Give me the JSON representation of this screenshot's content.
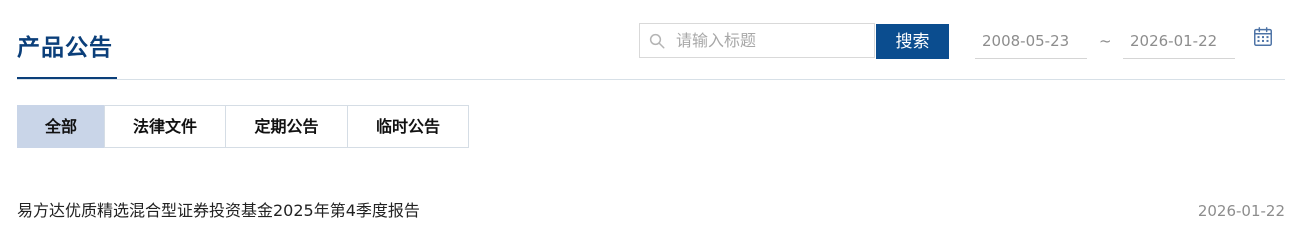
{
  "header": {
    "title": "产品公告"
  },
  "search": {
    "placeholder": "请输入标题",
    "button_label": "搜索",
    "icon": "search-icon"
  },
  "date_range": {
    "start": "2008-05-23",
    "separator": "~",
    "end": "2026-01-22",
    "icon": "calendar-icon"
  },
  "tabs": [
    {
      "label": "全部",
      "active": true
    },
    {
      "label": "法律文件",
      "active": false
    },
    {
      "label": "定期公告",
      "active": false
    },
    {
      "label": "临时公告",
      "active": false
    }
  ],
  "announcements": [
    {
      "title": "易方达优质精选混合型证券投资基金2025年第4季度报告",
      "date": "2026-01-22"
    }
  ],
  "colors": {
    "brand": "#0b3f7a",
    "button": "#0b4d8f",
    "active_tab": "#c9d5e8",
    "muted_text": "#8d8d8d"
  }
}
